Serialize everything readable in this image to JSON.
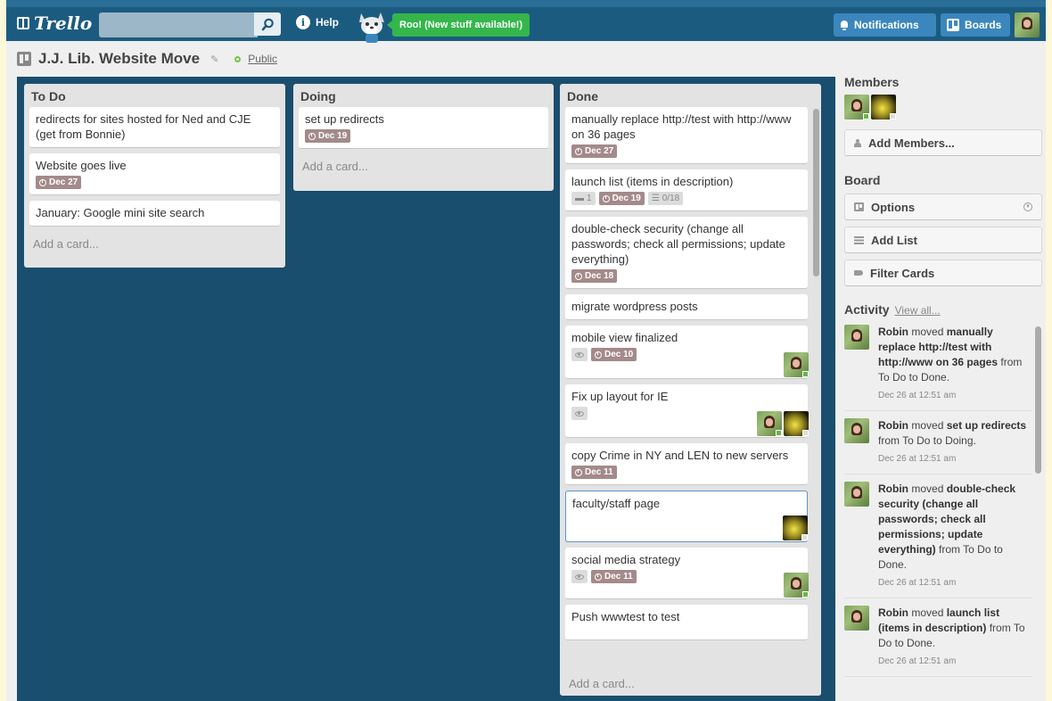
{
  "header": {
    "logo": "Trello",
    "search_placeholder": "",
    "help_label": "Help",
    "roo_label": "Roo! (New stuff available!)",
    "notifications_label": "Notifications",
    "boards_label": "Boards"
  },
  "board": {
    "title": "J.J. Lib. Website Move",
    "visibility": "Public"
  },
  "lists": [
    {
      "title": "To Do",
      "cards": [
        {
          "text": "redirects for sites hosted for Ned and CJE (get from Bonnie)"
        },
        {
          "text": "Website goes live",
          "due": "Dec 27"
        },
        {
          "text": "January: Google mini site search"
        }
      ],
      "add_card": "Add a card..."
    },
    {
      "title": "Doing",
      "cards": [
        {
          "text": "set up redirects",
          "due": "Dec 19"
        }
      ],
      "add_card": "Add a card..."
    },
    {
      "title": "Done",
      "cards": [
        {
          "text": "manually replace http://test with http://www on 36 pages",
          "due": "Dec 27"
        },
        {
          "text": "launch list (items in description)",
          "comments": "1",
          "due": "Dec 19",
          "checklist": "0/18"
        },
        {
          "text": "double-check security (change all passwords; check all permissions; update everything)",
          "due": "Dec 18"
        },
        {
          "text": "migrate wordpress posts"
        },
        {
          "text": "mobile view finalized",
          "due": "Dec 10"
        },
        {
          "text": "Fix up layout for IE"
        },
        {
          "text": "copy Crime in NY and LEN to new servers",
          "due": "Dec 11"
        },
        {
          "text": "faculty/staff page"
        },
        {
          "text": "social media strategy",
          "due": "Dec 11"
        },
        {
          "text": "Push wwwtest to test"
        }
      ],
      "add_card": "Add a card..."
    }
  ],
  "sidebar": {
    "members_heading": "Members",
    "add_members": "Add Members...",
    "board_heading": "Board",
    "options": "Options",
    "add_list": "Add List",
    "filter_cards": "Filter Cards",
    "activity_heading": "Activity",
    "view_all": "View all...",
    "activity": [
      {
        "user": "Robin",
        "verb": "moved",
        "item": "manually replace http://test with http://www on 36 pages",
        "rest": "from To Do to Done.",
        "date": "Dec 26 at 12:51 am"
      },
      {
        "user": "Robin",
        "verb": "moved",
        "item": "set up redirects",
        "rest": "from To Do to Doing.",
        "date": "Dec 26 at 12:51 am"
      },
      {
        "user": "Robin",
        "verb": "moved",
        "item": "double-check security (change all passwords; check all permissions; update everything)",
        "rest": "from To Do to Done.",
        "date": "Dec 26 at 12:51 am"
      },
      {
        "user": "Robin",
        "verb": "moved",
        "item": "launch list (items in description)",
        "rest": "from To Do to Done.",
        "date": "Dec 26 at 12:51 am"
      }
    ]
  },
  "colors": {
    "header_bg": "#1c5b80",
    "board_bg": "#1a4e6e",
    "roo_green": "#34b64b",
    "due_badge": "#a48a8a"
  }
}
